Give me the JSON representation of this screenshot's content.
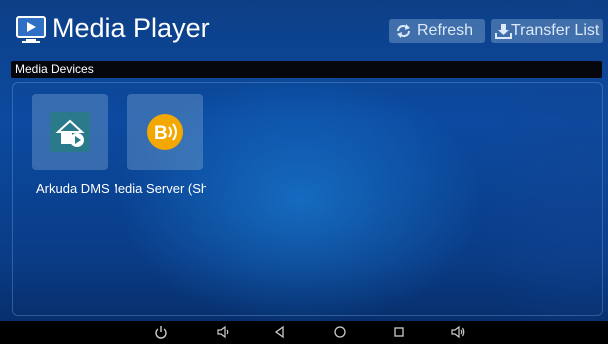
{
  "app": {
    "title": "Media Player",
    "refresh_label": "Refresh",
    "transfer_label": "Transfer List"
  },
  "section": {
    "label": "Media Devices"
  },
  "devices": [
    {
      "label": "Arkuda DMS",
      "icon": "arkuda-dms-icon"
    },
    {
      "label": "Media Server (Sh",
      "icon": "media-server-icon"
    }
  ],
  "navbar": {
    "icons": [
      "power-icon",
      "volume-down-icon",
      "back-icon",
      "home-icon",
      "recents-icon",
      "volume-up-icon"
    ]
  },
  "colors": {
    "accent": "#0b4aa0",
    "button_bg": "#7fa6cf",
    "tile_icon_bg": "#2b7a8c",
    "server_icon": "#f3a800"
  }
}
